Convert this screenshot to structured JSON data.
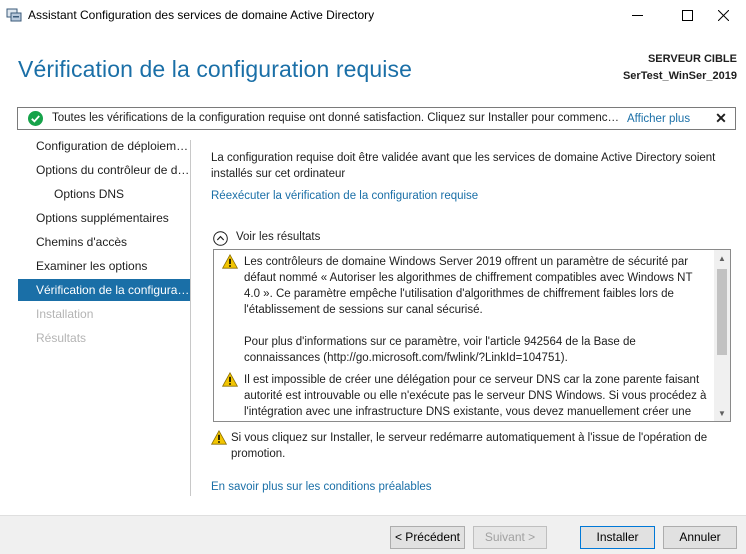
{
  "window": {
    "title": "Assistant Configuration des services de domaine Active Directory",
    "minimize_icon": "minimize-icon",
    "maximize_icon": "maximize-icon",
    "close_icon": "close-icon"
  },
  "header": {
    "title": "Vérification de la configuration requise",
    "target_label": "SERVEUR CIBLE",
    "target_value": "SerTest_WinSer_2019"
  },
  "notification": {
    "icon": "success-check-icon",
    "text": "Toutes les vérifications de la configuration requise ont donné satisfaction. Cliquez sur Installer pour commencer l'installation.",
    "more_link": "Afficher plus",
    "close_label": "✕"
  },
  "sidebar": {
    "items": [
      {
        "label": "Configuration de déploiement",
        "state": "normal"
      },
      {
        "label": "Options du contrôleur de domaine",
        "state": "normal"
      },
      {
        "label": "Options DNS",
        "state": "normal"
      },
      {
        "label": "Options supplémentaires",
        "state": "normal"
      },
      {
        "label": "Chemins d'accès",
        "state": "normal"
      },
      {
        "label": "Examiner les options",
        "state": "normal"
      },
      {
        "label": "Vérification de la configuration requise",
        "state": "active"
      },
      {
        "label": "Installation",
        "state": "disabled"
      },
      {
        "label": "Résultats",
        "state": "disabled"
      }
    ]
  },
  "main": {
    "intro": "La configuration requise doit être validée avant que les services de domaine Active Directory soient installés sur cet ordinateur",
    "rerun_link": "Réexécuter la vérification de la configuration requise",
    "results_toggle": "Voir les résultats",
    "results": [
      {
        "icon": "warning-icon",
        "text": "Les contrôleurs de domaine Windows Server 2019 offrent un paramètre de sécurité par défaut nommé « Autoriser les algorithmes de chiffrement compatibles avec Windows NT 4.0 ». Ce paramètre empêche l'utilisation d'algorithmes de chiffrement faibles lors de l'établissement de sessions sur canal sécurisé."
      },
      {
        "icon": "",
        "text": "Pour plus d'informations sur ce paramètre, voir l'article 942564 de la Base de connaissances (http://go.microsoft.com/fwlink/?LinkId=104751)."
      },
      {
        "icon": "warning-icon",
        "text": "Il est impossible de créer une délégation pour ce serveur DNS car la zone parente faisant autorité est introuvable ou elle n'exécute pas le serveur DNS Windows. Si vous procédez à l'intégration avec une infrastructure DNS existante, vous devez manuellement créer une délégation avec ce serveur DNS dans la zone parente"
      }
    ],
    "restart_note": "Si vous cliquez sur Installer, le serveur redémarre automatiquement à l'issue de l'opération de promotion.",
    "learn_more_link": "En savoir plus sur les conditions préalables"
  },
  "footer": {
    "previous": "< Précédent",
    "next": "Suivant >",
    "install": "Installer",
    "cancel": "Annuler"
  },
  "colors": {
    "accent": "#1a6fa7",
    "success": "#16a34a",
    "warning": "#f2c500"
  }
}
